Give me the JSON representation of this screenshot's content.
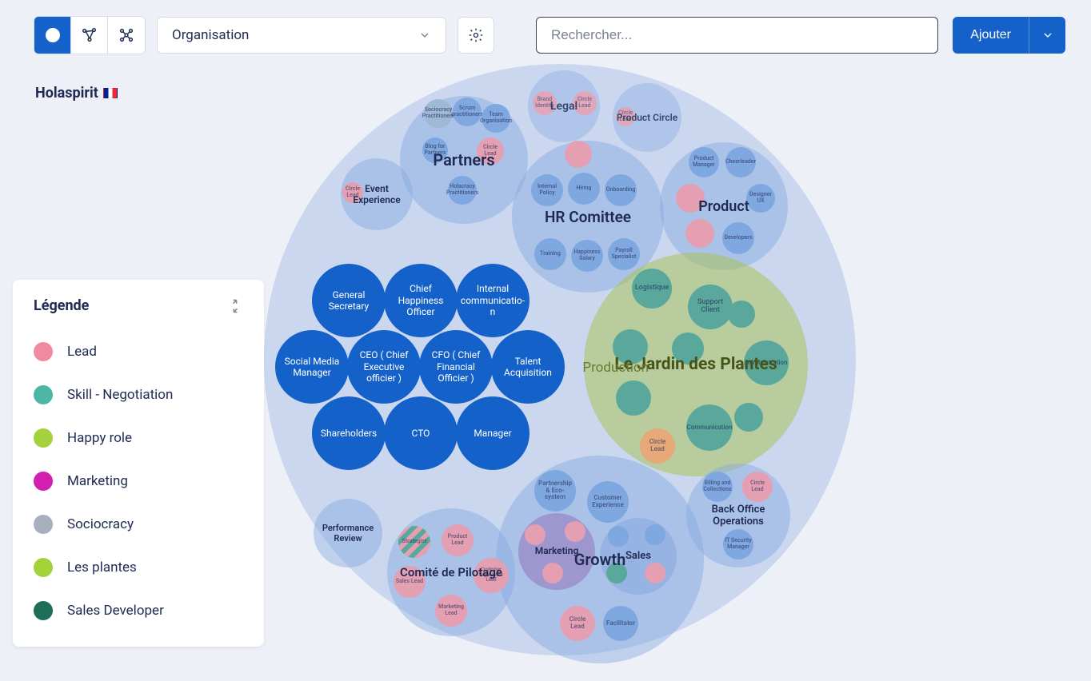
{
  "toolbar": {
    "select_label": "Organisation",
    "search_placeholder": "Rechercher...",
    "add_label": "Ajouter"
  },
  "org": {
    "name": "Holaspirit",
    "flag": "FR"
  },
  "legend": {
    "title": "Légende",
    "items": [
      {
        "label": "Lead",
        "color": "#f08aa0"
      },
      {
        "label": "Skill - Negotiation",
        "color": "#4db6a4"
      },
      {
        "label": "Happy role",
        "color": "#a4d23b"
      },
      {
        "label": "Marketing",
        "color": "#d31fb0"
      },
      {
        "label": "Sociocracy",
        "color": "#a9b0bd"
      },
      {
        "label": "Les plantes",
        "color": "#a4d23b"
      },
      {
        "label": "Sales Developer",
        "color": "#1f6e5a"
      }
    ]
  },
  "circles": {
    "partners": {
      "label": "Partners",
      "children": [
        "Sociocracy Practitioners",
        "Scrum practitioners",
        "Team Organisation",
        "Blog for Partners",
        "Circle Lead",
        "Holacracy Practitioners"
      ]
    },
    "event_experience": {
      "label": "Event Experience",
      "children": [
        "Circle Lead"
      ]
    },
    "legal": {
      "label": "Legal",
      "children": [
        "Brand Identity",
        "Circle Lead"
      ]
    },
    "product_circle": {
      "label": "Product Circle",
      "children": [
        "Circle Lead"
      ]
    },
    "hr": {
      "label": "HR Comittee",
      "children": [
        "Internal Policy",
        "Hiring",
        "Onboarding",
        "Training",
        "Happiness Salary",
        "Payroll Specialist"
      ]
    },
    "product": {
      "label": "Product",
      "children": [
        "Product Manager",
        "Cheerleader",
        "",
        "Designer UX",
        "",
        "",
        "Developers"
      ]
    },
    "jardin": {
      "label": "Le Jardin des Plantes",
      "sub": "Production",
      "children": [
        "Logistique",
        "Support Client",
        "Administration",
        "Communication",
        "Circle Lead"
      ]
    },
    "growth": {
      "label": "Growth",
      "children": [
        "Partnership & Eco-system",
        "Customer Experience",
        "Marketing",
        "Sales",
        "Circle Lead",
        "Facilitator"
      ]
    },
    "backoffice": {
      "label": "Back Office Operations",
      "children": [
        "Billing and Collections",
        "Circle Lead",
        "IT Security Manager"
      ]
    },
    "comite": {
      "label": "Comité de Pilotage",
      "children": [
        "Strategist",
        "Product Lead",
        "Sales Lead",
        "Customer Experience Lead",
        "Marketing Lead"
      ]
    },
    "perf": {
      "label": "Performance Review"
    },
    "roles": [
      "General Secretary",
      "Chief Happiness Officer",
      "Internal communicatio-n",
      "Social Media Manager",
      "CEO ( Chief Executive officier )",
      "CFO ( Chief Financial Officier )",
      "Talent Acquisition",
      "Shareholders",
      "CTO",
      "Manager"
    ]
  }
}
